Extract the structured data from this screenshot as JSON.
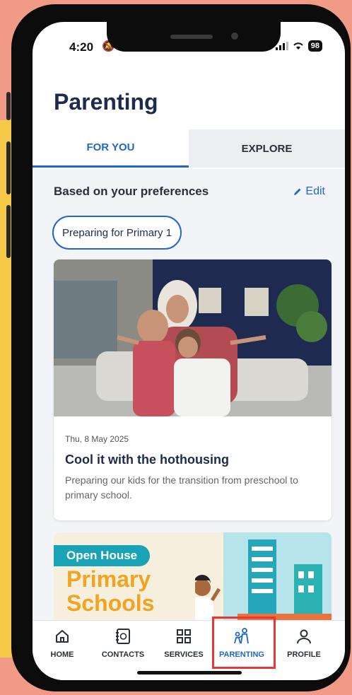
{
  "status_bar": {
    "time": "4:20",
    "battery": "98"
  },
  "page": {
    "title": "Parenting"
  },
  "tabs": [
    {
      "label": "FOR YOU",
      "active": true
    },
    {
      "label": "EXPLORE",
      "active": false
    }
  ],
  "preferences": {
    "heading": "Based on your preferences",
    "edit_label": "Edit",
    "chips": [
      "Preparing for Primary 1"
    ]
  },
  "articles": [
    {
      "date": "Thu, 8 May 2025",
      "title": "Cool it with the hothousing",
      "description": "Preparing our kids for the transition from preschool to primary school."
    }
  ],
  "promo": {
    "badge": "Open House",
    "line1": "Primary",
    "line2": "Schools"
  },
  "bottom_nav": [
    {
      "label": "HOME",
      "icon": "home-icon",
      "active": false
    },
    {
      "label": "CONTACTS",
      "icon": "contacts-icon",
      "active": false
    },
    {
      "label": "SERVICES",
      "icon": "services-icon",
      "active": false
    },
    {
      "label": "PARENTING",
      "icon": "parenting-icon",
      "active": true
    },
    {
      "label": "PROFILE",
      "icon": "profile-icon",
      "active": false
    }
  ],
  "colors": {
    "accent": "#1f67c9",
    "title": "#1d2b4f",
    "highlight": "#e53935",
    "background": "#f19a86"
  }
}
